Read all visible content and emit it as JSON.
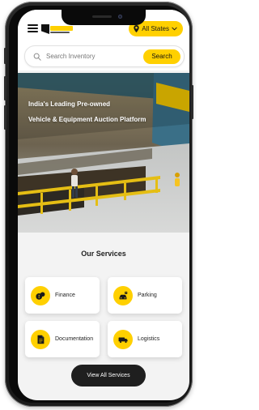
{
  "header": {
    "logo_alt": "site logo",
    "location_label": "All States",
    "location_icon": "location-pin-icon",
    "dropdown_icon": "chevron-down-icon"
  },
  "search": {
    "placeholder": "Search Inventory",
    "button_label": "Search",
    "icon": "search-icon"
  },
  "hero": {
    "line1": "India's Leading Pre-owned",
    "line2": "Vehicle & Equipment Auction Platform"
  },
  "services": {
    "title": "Our Services",
    "items": [
      {
        "label": "Finance",
        "icon": "finance-icon"
      },
      {
        "label": "Parking",
        "icon": "parking-icon"
      },
      {
        "label": "Documentation",
        "icon": "documentation-icon"
      },
      {
        "label": "Logistics",
        "icon": "logistics-icon"
      }
    ],
    "button_label": "View All Services"
  },
  "colors": {
    "brand_yellow": "#ffd000",
    "button_dark": "#1f1f1f",
    "text_dark": "#222222"
  }
}
